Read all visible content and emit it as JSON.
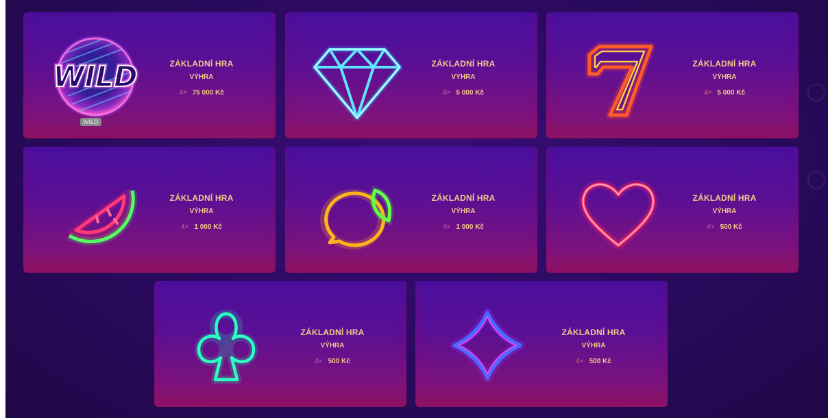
{
  "colors": {
    "background": "#2a0a5e",
    "card_top": "#4a0f9e",
    "card_bottom": "#8a1668",
    "text_gold": "#f3c98a",
    "multiplier": "#d06a8e"
  },
  "paytable": [
    {
      "icon": "wild-icon",
      "title": "ZÁKLADNÍ HRA",
      "subtitle": "VÝHRA",
      "multiplier": "4×",
      "amount": "75 000 Kč",
      "badge": "WILD"
    },
    {
      "icon": "diamond-gem-icon",
      "title": "ZÁKLADNÍ HRA",
      "subtitle": "VÝHRA",
      "multiplier": "4×",
      "amount": "5 000 Kč"
    },
    {
      "icon": "lucky-seven-icon",
      "title": "ZÁKLADNÍ HRA",
      "subtitle": "VÝHRA",
      "multiplier": "4×",
      "amount": "5 000 Kč"
    },
    {
      "icon": "watermelon-icon",
      "title": "ZÁKLADNÍ HRA",
      "subtitle": "VÝHRA",
      "multiplier": "4×",
      "amount": "1 000 Kč"
    },
    {
      "icon": "lemon-icon",
      "title": "ZÁKLADNÍ HRA",
      "subtitle": "VÝHRA",
      "multiplier": "4×",
      "amount": "1 000 Kč"
    },
    {
      "icon": "heart-icon",
      "title": "ZÁKLADNÍ HRA",
      "subtitle": "VÝHRA",
      "multiplier": "4×",
      "amount": "500 Kč"
    },
    {
      "icon": "club-icon",
      "title": "ZÁKLADNÍ HRA",
      "subtitle": "VÝHRA",
      "multiplier": "4×",
      "amount": "500 Kč"
    },
    {
      "icon": "diamond-suit-icon",
      "title": "ZÁKLADNÍ HRA",
      "subtitle": "VÝHRA",
      "multiplier": "4×",
      "amount": "500 Kč"
    }
  ]
}
